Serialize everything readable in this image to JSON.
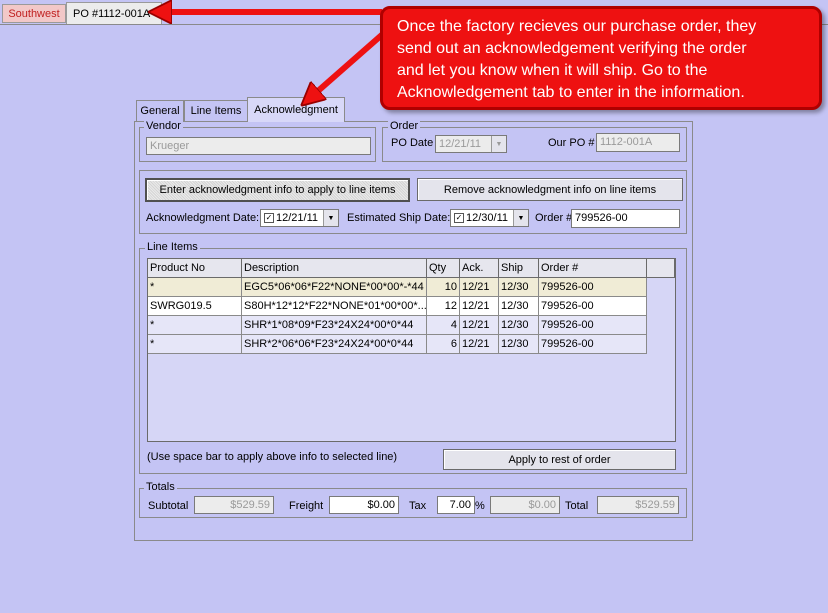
{
  "window_tabs": [
    "Southwest",
    "PO #1112-001A"
  ],
  "callout": {
    "lines": [
      "Once the factory recieves our purchase order, they",
      "send out an acknowledgement verifying the order",
      "and let you know when it will ship.  Go to the",
      "Acknowledgement tab to enter in the information."
    ]
  },
  "tabs": [
    "General",
    "Line  Items",
    "Acknowledgment"
  ],
  "vendor": {
    "label": "Vendor",
    "value": "Krueger"
  },
  "order": {
    "label": "Order",
    "po_date_label": "PO Date",
    "po_date": "12/21/11",
    "our_po_label": "Our PO #",
    "our_po": "1112-001A"
  },
  "ack": {
    "enter_button": "Enter acknowledgment info to apply to line items",
    "remove_button": "Remove acknowledgment info on line items",
    "ack_date_label": "Acknowledgment Date:",
    "ack_date": "12/21/11",
    "ship_date_label": "Estimated Ship Date:",
    "ship_date": "12/30/11",
    "order_no_label": "Order #",
    "order_no": "799526-00"
  },
  "line_items": {
    "label": "Line Items",
    "columns": [
      "Product No",
      "Description",
      "Qty",
      "Ack.",
      "Ship",
      "Order #"
    ],
    "rows": [
      [
        "*",
        "EGC5*06*06*F22*NONE*00*00*-*44",
        "10",
        "12/21",
        "12/30",
        "799526-00"
      ],
      [
        "SWRG019.5",
        "S80H*12*12*F22*NONE*01*00*00*...",
        "12",
        "12/21",
        "12/30",
        "799526-00"
      ],
      [
        "*",
        "SHR*1*08*09*F23*24X24*00*0*44",
        "4",
        "12/21",
        "12/30",
        "799526-00"
      ],
      [
        "*",
        "SHR*2*06*06*F23*24X24*00*0*44",
        "6",
        "12/21",
        "12/30",
        "799526-00"
      ]
    ],
    "hint": "(Use space bar to apply above info to selected line)",
    "apply_button": "Apply to rest of order"
  },
  "totals": {
    "label": "Totals",
    "subtotal_label": "Subtotal",
    "subtotal": "$529.59",
    "freight_label": "Freight",
    "freight": "$0.00",
    "tax_label": "Tax",
    "tax_rate": "7.00",
    "tax_pct": "%",
    "tax_amount": "$0.00",
    "total_label": "Total",
    "total": "$529.59"
  },
  "colors": {
    "background": "#c4c4f4",
    "callout": "#ee1111",
    "callout_border": "#b00000",
    "tab_southwest": "#f2c8c8"
  },
  "icons": {
    "dropdown": "chevron-down-icon",
    "date_check": "checkbox-icon"
  }
}
